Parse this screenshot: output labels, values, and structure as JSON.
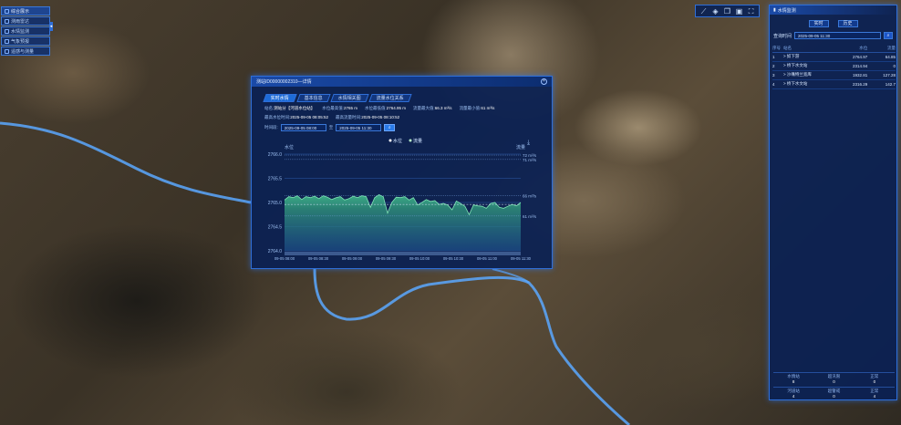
{
  "left_nav": {
    "items": [
      {
        "label": "综合展示",
        "icon": "layers-icon"
      },
      {
        "label": "测雨雷达",
        "icon": "radar-icon"
      },
      {
        "label": "水情监测",
        "icon": "water-icon"
      },
      {
        "label": "气象预报",
        "icon": "cloud-icon"
      },
      {
        "label": "遥感与测量",
        "icon": "satellite-icon"
      }
    ],
    "toggle": "◂"
  },
  "tools": [
    "ruler-icon",
    "layers-icon",
    "copy-icon",
    "window-icon",
    "fullscreen-icon"
  ],
  "right_panel": {
    "title": "水情监测",
    "buttons": {
      "realtime": "实时",
      "history": "历史"
    },
    "query_label": "查询时间",
    "query_value": "2025-09-05 11:30",
    "search_icon": "⌕",
    "headers": [
      "序号",
      "站名",
      "水位",
      "流量"
    ],
    "rows": [
      {
        "no": "1",
        "name": "> 奴下游",
        "level": "2764.97",
        "flow": "64.85"
      },
      {
        "no": "2",
        "name": "> 桥下水文站",
        "level": "2314.94",
        "flow": "0"
      },
      {
        "no": "3",
        "name": "> 沙嘴特兰宽库",
        "level": "1932.81",
        "flow": "127.28"
      },
      {
        "no": "4",
        "name": "> 桥下水文站",
        "level": "2316.29",
        "flow": "142.7"
      }
    ],
    "stats": [
      {
        "label": "水情站",
        "value": "8"
      },
      {
        "label": "超汛限",
        "value": "0"
      },
      {
        "label": "正常",
        "value": "0"
      },
      {
        "label": "河道站",
        "value": "4"
      },
      {
        "label": "超警戒",
        "value": "0"
      },
      {
        "label": "正常",
        "value": "4"
      }
    ]
  },
  "dialog": {
    "title": "测站ID00000002310—详情",
    "close": "×",
    "tabs": [
      "实时水情",
      "基本信息",
      "水情相关图",
      "流量水位关系"
    ],
    "info1": {
      "station_label": "站名:",
      "station": "测站分【河道水位站】",
      "level_label": "水位最高值:",
      "level_max": "2765 m",
      "level_min_label": "水位最低值:",
      "level_min": "2764.95 m",
      "flow_max_label": "流量最大值:",
      "flow_max": "66.3 m³/s",
      "flow_min_label": "流量最小值:",
      "flow_min": "61 m³/s"
    },
    "info2": {
      "t_max_label": "最高水位时间:",
      "t_max": "2025-09-05 08:05:52",
      "t_min_label": "最高流量时间:",
      "t_min": "2025-09-05 08:10:52"
    },
    "query": {
      "label": "时间段:",
      "from": "2025-09-05 08:00",
      "to_label": "至",
      "to": "2025-09-05 11:30",
      "btn": "⌕"
    }
  },
  "chart_data": {
    "type": "area",
    "legend": [
      "水位",
      "流量"
    ],
    "ylabel_left": "水位",
    "ylabel_right": "流量",
    "yticks_left": [
      "2766.0",
      "2765.5",
      "2765.0",
      "2764.5",
      "2764.0"
    ],
    "ylim_left": [
      2764.0,
      2766.0
    ],
    "right_labels": [
      {
        "text": "72 m³/s",
        "level": 2765.98
      },
      {
        "text": "71 m³/s",
        "level": 2765.89
      },
      {
        "text": "66 m³/s",
        "level": 2765.14
      },
      {
        "text": "61 m³/s",
        "level": 2764.72
      }
    ],
    "x": [
      "09-05 08:00",
      "09-05 08:30",
      "09-05 09:00",
      "09-05 09:30",
      "09-05 10:00",
      "09-05 10:30",
      "09-05 11:00",
      "09-05 11:30"
    ],
    "level_series": [
      2765.05,
      2765.12,
      2765.1,
      2765.14,
      2765.06,
      2765.12,
      2765.1,
      2765.13,
      2765.08,
      2765.14,
      2765.11,
      2765.06,
      2765.1,
      2765.12,
      2765.05,
      2765.08,
      2765.13,
      2765.1,
      2765.14,
      2765.12,
      2764.9,
      2765.1,
      2765.16,
      2765.12,
      2764.78,
      2765.0,
      2765.11,
      2765.1,
      2765.12,
      2765.05,
      2765.1,
      2764.95,
      2765.0,
      2765.06,
      2765.02,
      2765.04,
      2764.96,
      2764.98,
      2764.95,
      2764.85,
      2765.03,
      2764.98,
      2764.92,
      2764.75,
      2764.95,
      2764.93,
      2764.92,
      2764.88,
      2764.98,
      2765.0,
      2764.9,
      2764.88,
      2764.92,
      2764.96,
      2764.93,
      2765.0
    ],
    "flow_ref_level": 2764.96
  }
}
